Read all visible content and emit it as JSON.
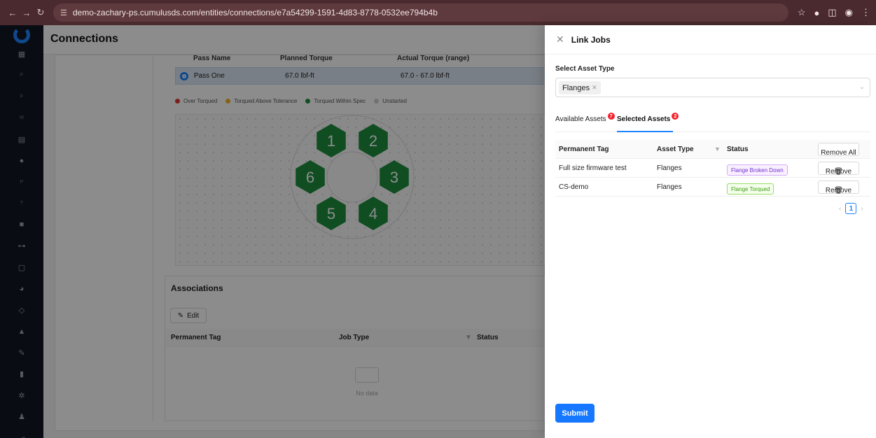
{
  "browser": {
    "url": "demo-zachary-ps.cumulusds.com/entities/connections/e7a54299-1591-4d83-8778-0532ee794b4b"
  },
  "sidebar": {
    "items": [
      {
        "icon": "dashboard-icon",
        "glyph": "▦"
      },
      {
        "icon": "f-letter-icon",
        "glyph": "F",
        "small": true
      },
      {
        "icon": "f-letter-icon",
        "glyph": "F",
        "small": true
      },
      {
        "icon": "m-letter-icon",
        "glyph": "M",
        "small": true
      },
      {
        "icon": "calendar-icon",
        "glyph": "▤"
      },
      {
        "icon": "gear-icon",
        "glyph": "●"
      },
      {
        "icon": "p-letter-icon",
        "glyph": "P",
        "small": true
      },
      {
        "icon": "t-letter-icon",
        "glyph": "T",
        "small": true
      },
      {
        "icon": "folder-icon",
        "glyph": "■"
      },
      {
        "icon": "link-icon",
        "glyph": "⊶"
      },
      {
        "icon": "document-icon",
        "glyph": "▢"
      },
      {
        "icon": "pie-chart-icon",
        "glyph": "◕"
      },
      {
        "icon": "eye-icon",
        "glyph": "◇"
      },
      {
        "icon": "warning-icon",
        "glyph": "▲"
      },
      {
        "icon": "wrench-icon",
        "glyph": "✎"
      },
      {
        "icon": "clipboard-icon",
        "glyph": "▮"
      },
      {
        "icon": "settings-icon",
        "glyph": "✲"
      },
      {
        "icon": "users-icon",
        "glyph": "♟"
      },
      {
        "icon": "logout-icon",
        "glyph": "⇥"
      }
    ]
  },
  "page": {
    "title": "Connections",
    "pass_table": {
      "headers": [
        "Pass Name",
        "Planned Torque",
        "Actual Torque (range)"
      ],
      "rows": [
        [
          "Pass One",
          "67.0 lbf-ft",
          "67.0 - 67.0 lbf-ft"
        ]
      ]
    },
    "legend": [
      {
        "label": "Over Torqued",
        "color": "#e53935"
      },
      {
        "label": "Torqued Above Tolerance",
        "color": "#f0b429"
      },
      {
        "label": "Torqued Within Spec",
        "color": "#1e8e3e"
      },
      {
        "label": "Unstarted",
        "color": "#cfcfcf"
      }
    ],
    "bolts": [
      "1",
      "2",
      "3",
      "4",
      "5",
      "6"
    ],
    "bolt_color": "#1e8e3e",
    "associations": {
      "title": "Associations",
      "edit_label": "Edit",
      "headers": [
        "Permanent Tag",
        "Job Type",
        "Status"
      ],
      "empty_text": "No data"
    }
  },
  "drawer": {
    "title": "Link Jobs",
    "select_label": "Select Asset Type",
    "selected_tag": "Flanges",
    "tabs": [
      {
        "label": "Available Assets",
        "badge": "7"
      },
      {
        "label": "Selected Assets",
        "badge": "2"
      }
    ],
    "table": {
      "headers": [
        "Permanent Tag",
        "Asset Type",
        "Status"
      ],
      "remove_all_label": "Remove All",
      "rows": [
        {
          "tag": "Full size firmware test",
          "type": "Flanges",
          "status": "Flange Broken Down",
          "remove": "Remove"
        },
        {
          "tag": "CS-demo",
          "type": "Flanges",
          "status": "Flange Torqued",
          "remove": "Remove"
        }
      ]
    },
    "page_number": "1",
    "submit_label": "Submit"
  }
}
